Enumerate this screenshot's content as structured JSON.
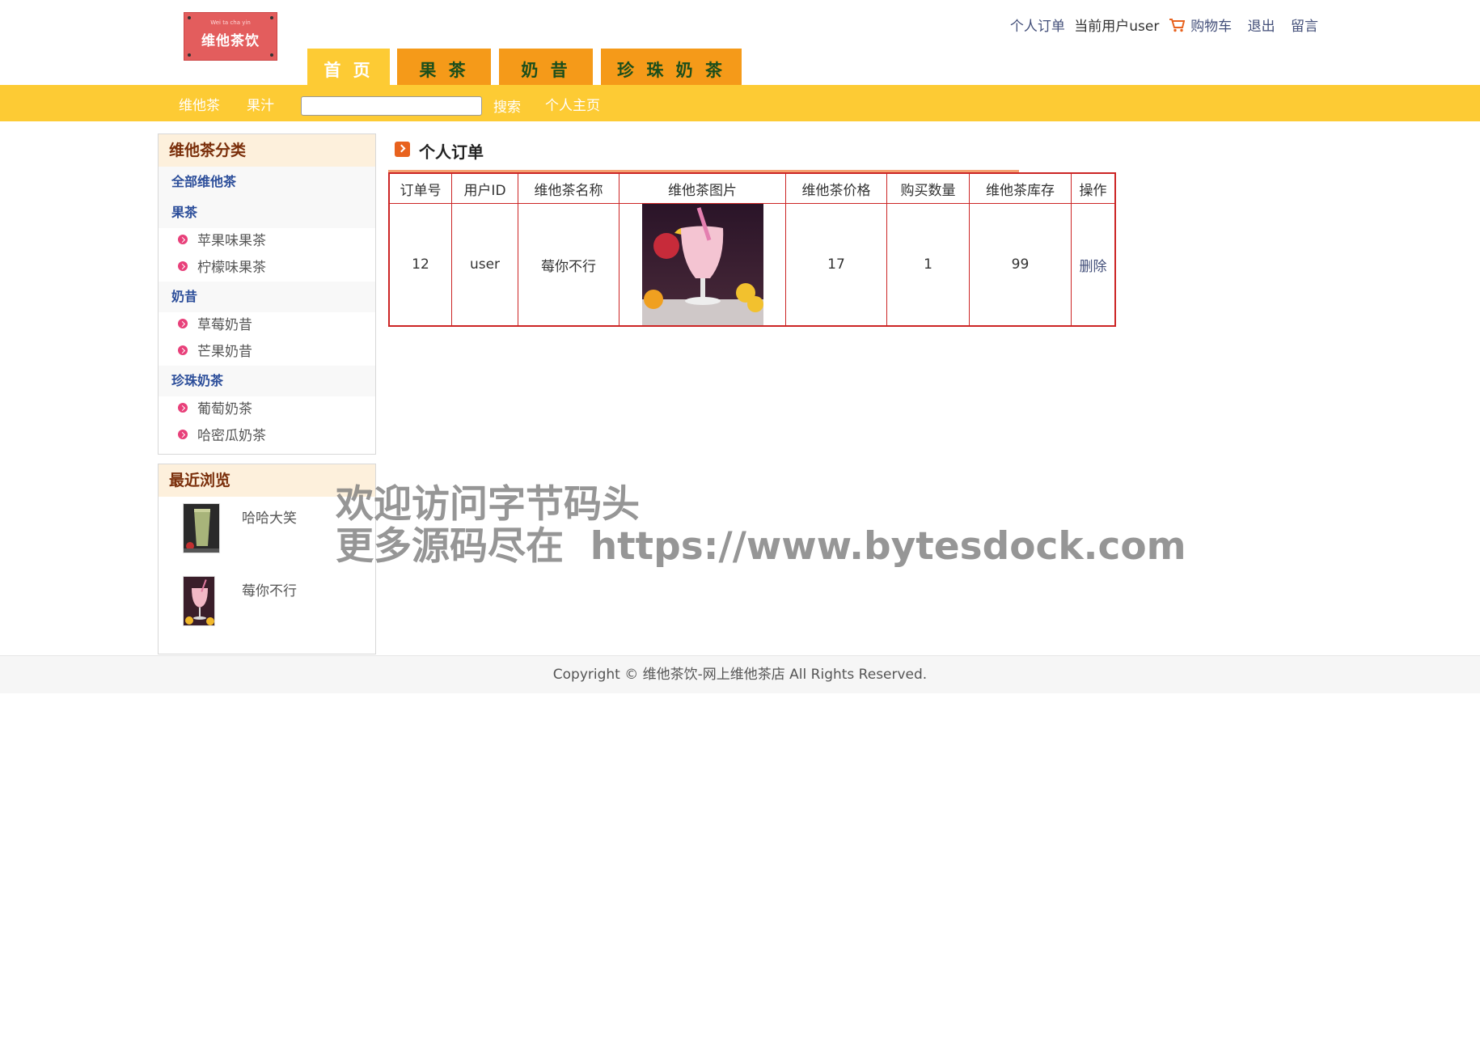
{
  "header": {
    "logo_small": "Wei ta cha yin",
    "logo_big": "维他茶饮",
    "tabs": [
      "首 页",
      "果 茶",
      "奶 昔",
      "珍 珠 奶 茶"
    ],
    "user_links": {
      "orders": "个人订单",
      "current_user": "当前用户user",
      "cart": "购物车",
      "logout": "退出",
      "message": "留言"
    }
  },
  "navbar": {
    "links": [
      "维他茶",
      "果汁"
    ],
    "search_value": "",
    "search_button": "搜索",
    "profile": "个人主页"
  },
  "sidebar": {
    "categories_title": "维他茶分类",
    "all": "全部维他茶",
    "groups": [
      {
        "name": "果茶",
        "items": [
          "苹果味果茶",
          "柠檬味果茶"
        ]
      },
      {
        "name": "奶昔",
        "items": [
          "草莓奶昔",
          "芒果奶昔"
        ]
      },
      {
        "name": "珍珠奶茶",
        "items": [
          "葡萄奶茶",
          "哈密瓜奶茶"
        ]
      }
    ],
    "recent_title": "最近浏览",
    "recent": [
      "哈哈大笑",
      "莓你不行"
    ]
  },
  "main": {
    "title": "个人订单",
    "columns": [
      "订单号",
      "用户ID",
      "维他茶名称",
      "维他茶图片",
      "维他茶价格",
      "购买数量",
      "维他茶库存",
      "操作"
    ],
    "rows": [
      {
        "order_id": "12",
        "user_id": "user",
        "name": "莓你不行",
        "price": "17",
        "quantity": "1",
        "stock": "99",
        "action": "删除"
      }
    ]
  },
  "footer": {
    "copyright": "Copyright © 维他茶饮-网上维他茶店 All Rights Reserved."
  },
  "watermark": {
    "line1": "欢迎访问字节码头",
    "line2": "更多源码尽在  https://www.bytesdock.com"
  },
  "colors": {
    "nav_yellow": "#fdcb34",
    "tab_orange": "#f59a19",
    "table_border": "#cc2525",
    "link_blue": "#44507a"
  }
}
